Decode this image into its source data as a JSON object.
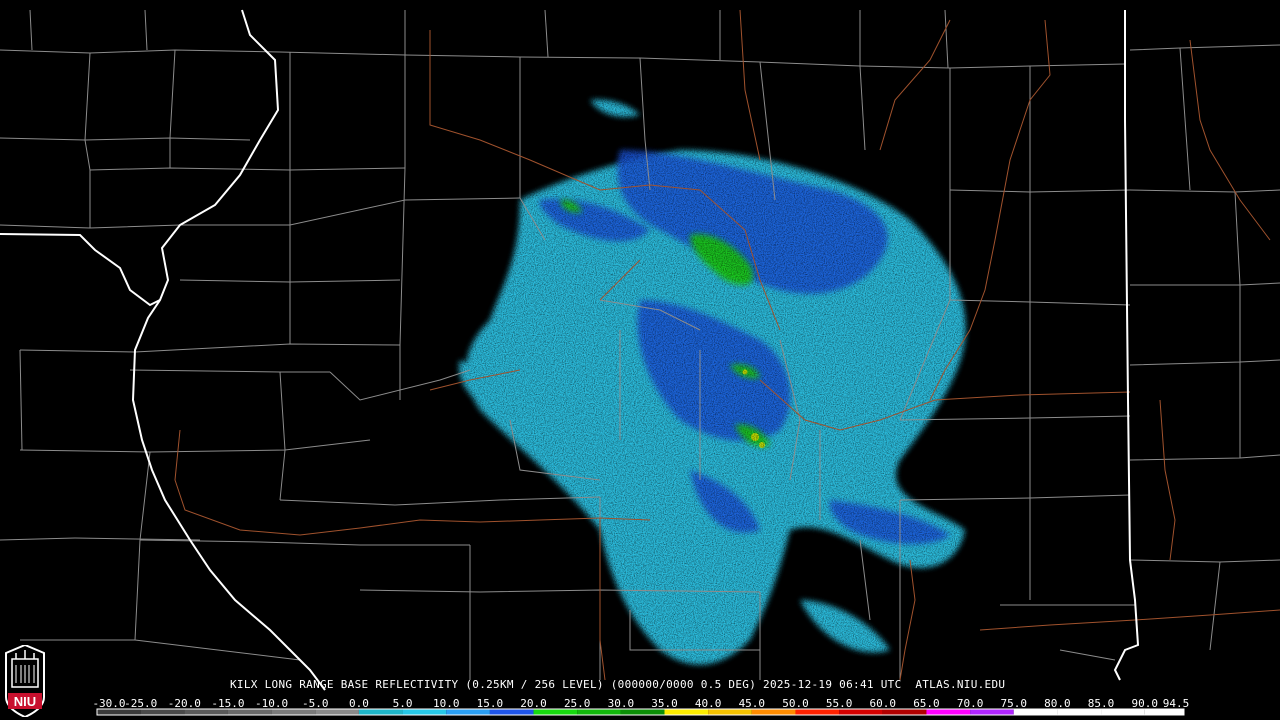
{
  "product_title": "KILX LONG RANGE BASE REFLECTIVITY (0.25KM / 256 LEVEL) (000000/0000 0.5 DEG) 2025-12-19 06:41 UTC  ATLAS.NIU.EDU",
  "logo_text": "NIU",
  "colorbar": {
    "labels": [
      "-30.0",
      "-25.0",
      "-20.0",
      "-15.0",
      "-10.0",
      "-5.0",
      "0.0",
      "5.0",
      "10.0",
      "15.0",
      "20.0",
      "25.0",
      "30.0",
      "35.0",
      "40.0",
      "45.0",
      "50.0",
      "55.0",
      "60.0",
      "65.0",
      "70.0",
      "75.0",
      "80.0",
      "85.0",
      "90.0",
      "94.5"
    ],
    "colors": [
      "#3a3a3a",
      "#4a4a4a",
      "#5a5a5a",
      "#6a6a6a",
      "#7a7a7a",
      "#8a8a8a",
      "#1fb6c9",
      "#27c7e6",
      "#2a9ef2",
      "#1f54e8",
      "#17d90f",
      "#12b70b",
      "#0c8f07",
      "#fcec00",
      "#f4c100",
      "#ff8c00",
      "#ff2200",
      "#d40000",
      "#b00000",
      "#ff00ff",
      "#b026ff",
      "#ffffff",
      "#ffffff",
      "#ffffff",
      "#ffffff"
    ],
    "start_value": -30.0,
    "end_value": 94.5
  },
  "colors": {
    "background": "#000000",
    "county_border": "#8c8c8c",
    "state_border": "#ffffff",
    "river": "#a0522d",
    "echo_light_cyan": "#2ec6e8",
    "echo_blue": "#1e5ae6",
    "echo_green": "#1bd80f",
    "echo_yellow": "#d8e800"
  }
}
